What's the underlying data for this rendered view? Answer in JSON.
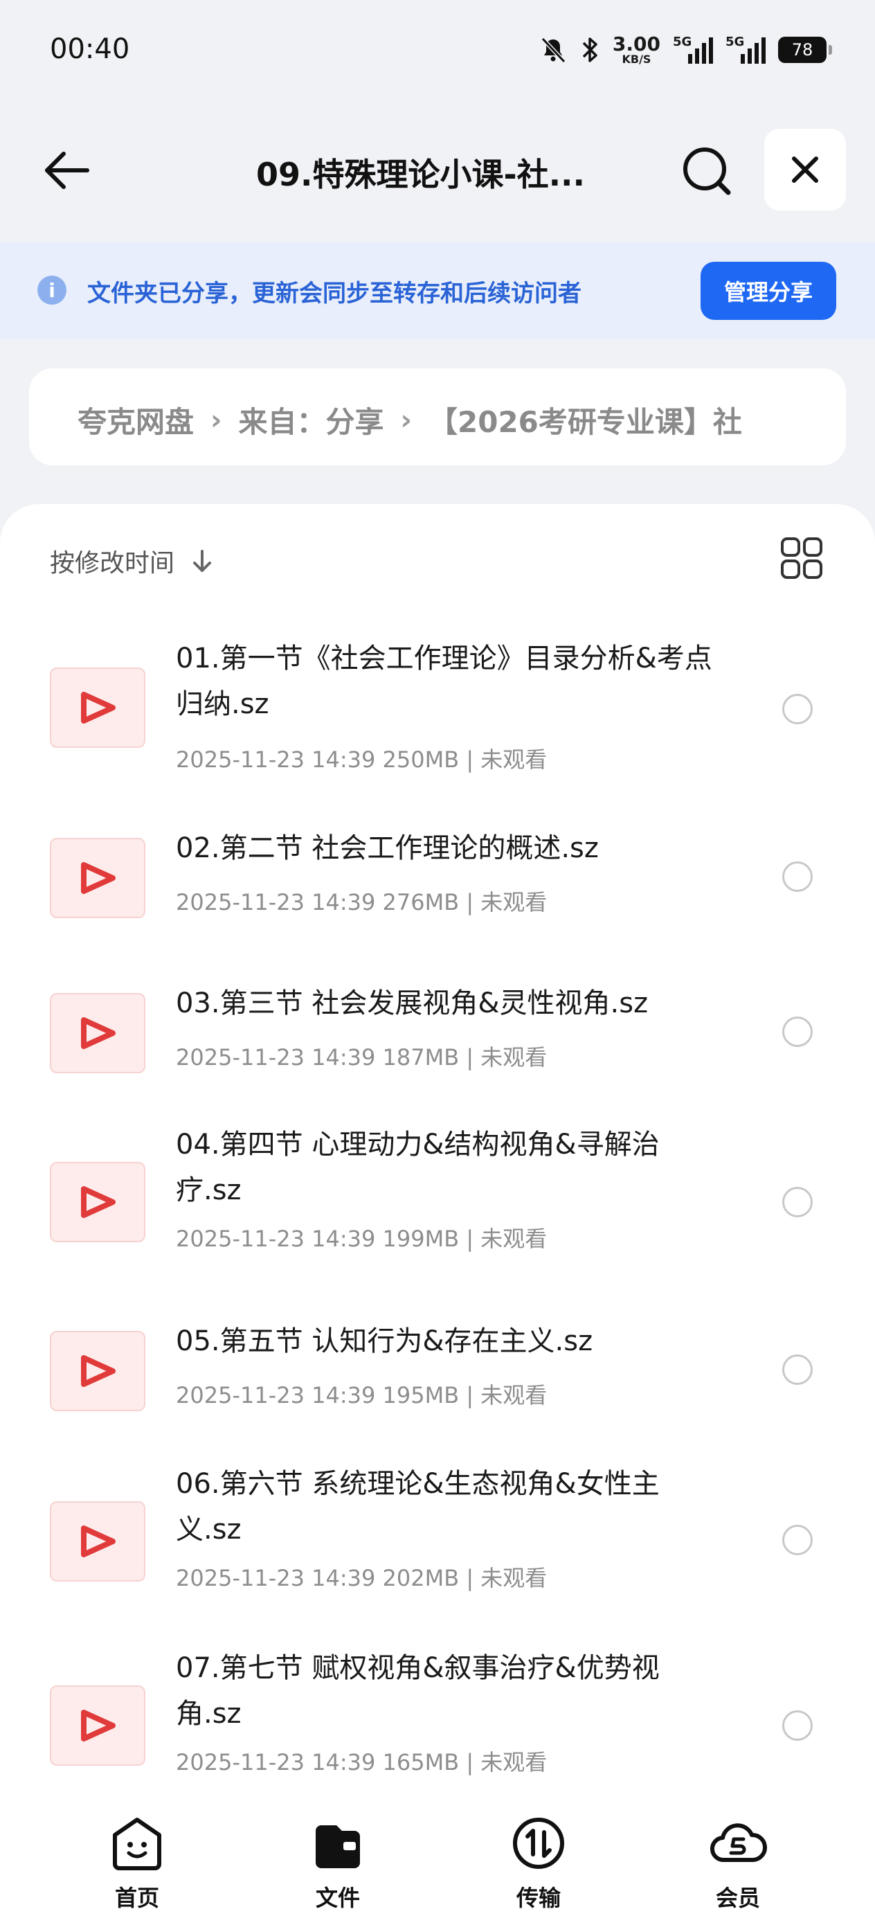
{
  "status_bar": {
    "time": "00:40",
    "speed_value": "3.00",
    "speed_unit": "KB/S",
    "sim1": "5G",
    "sim2": "5G",
    "battery": "78"
  },
  "header": {
    "title": "09.特殊理论小课-社..."
  },
  "banner": {
    "text": "文件夹已分享，更新会同步至转存和后续访问者",
    "manage_label": "管理分享"
  },
  "breadcrumb": {
    "items": [
      "夸克网盘",
      "来自：分享",
      "【2026考研专业课】社"
    ]
  },
  "sort": {
    "label": "按修改时间"
  },
  "files": [
    {
      "name": "01.第一节《社会工作理论》目录分析&考点归纳.sz",
      "meta": "2025-11-23 14:39 250MB | 未观看"
    },
    {
      "name": "02.第二节 社会工作理论的概述.sz",
      "meta": "2025-11-23 14:39 276MB | 未观看"
    },
    {
      "name": "03.第三节 社会发展视角&灵性视角.sz",
      "meta": "2025-11-23 14:39 187MB | 未观看"
    },
    {
      "name": "04.第四节 心理动力&结构视角&寻解治疗.sz",
      "meta": "2025-11-23 14:39 199MB | 未观看"
    },
    {
      "name": "05.第五节 认知行为&存在主义.sz",
      "meta": "2025-11-23 14:39 195MB | 未观看"
    },
    {
      "name": "06.第六节 系统理论&生态视角&女性主义.sz",
      "meta": "2025-11-23 14:39 202MB | 未观看"
    },
    {
      "name": "07.第七节 赋权视角&叙事治疗&优势视角.sz",
      "meta": "2025-11-23 14:39 165MB | 未观看"
    }
  ],
  "bottom_nav": [
    {
      "label": "首页",
      "icon": "home-face-icon"
    },
    {
      "label": "文件",
      "icon": "wallet-folder-icon"
    },
    {
      "label": "传输",
      "icon": "transfer-icon"
    },
    {
      "label": "会员",
      "icon": "vip-cloud-icon"
    }
  ],
  "colors": {
    "accent": "#1f68f3",
    "banner_bg": "#e8eefb",
    "banner_text": "#2a63d6",
    "video_icon": "#e03a3a"
  }
}
